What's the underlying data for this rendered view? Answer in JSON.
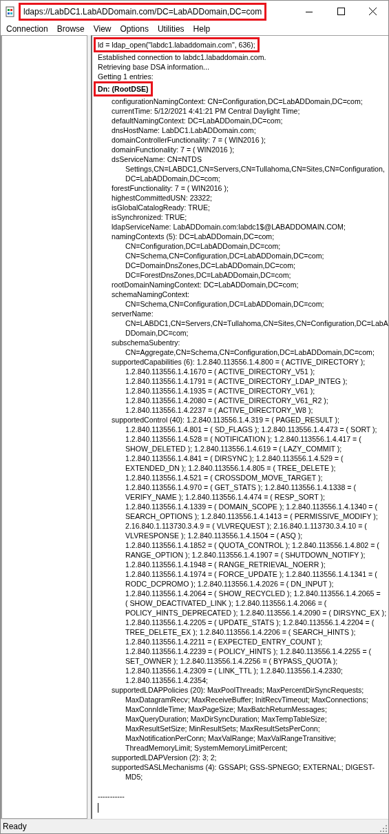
{
  "window": {
    "title": "ldaps://LabDC1.LabADDomain.com/DC=LabADDomain,DC=com",
    "title_highlighted": true
  },
  "menu": [
    "Connection",
    "Browse",
    "View",
    "Options",
    "Utilities",
    "Help"
  ],
  "log": [
    {
      "kind": "plain",
      "text": "ld = ldap_open(\"labdc1.labaddomain.com\", 636);",
      "highlighted": true
    },
    {
      "kind": "plain",
      "text": "Established connection to labdc1.labaddomain.com.",
      "highlighted": false
    },
    {
      "kind": "plain",
      "text": "Retrieving base DSA information...",
      "highlighted": false
    },
    {
      "kind": "plain",
      "text": "Getting 1 entries:",
      "highlighted": false
    },
    {
      "kind": "heading",
      "text": "Dn: (RootDSE)",
      "highlighted": true
    },
    {
      "kind": "attr",
      "text": "configurationNamingContext: CN=Configuration,DC=LabADDomain,DC=com;",
      "highlighted": false
    },
    {
      "kind": "attr",
      "text": "currentTime: 5/12/2021 4:41:21 PM Central Daylight Time;",
      "highlighted": false
    },
    {
      "kind": "attr",
      "text": "defaultNamingContext: DC=LabADDomain,DC=com;",
      "highlighted": false
    },
    {
      "kind": "attr",
      "text": "dnsHostName: LabDC1.LabADDomain.com;",
      "highlighted": false
    },
    {
      "kind": "attr",
      "text": "domainControllerFunctionality: 7 = ( WIN2016 );",
      "highlighted": false
    },
    {
      "kind": "attr",
      "text": "domainFunctionality: 7 = ( WIN2016 );",
      "highlighted": false
    },
    {
      "kind": "attr",
      "text": "dsServiceName: CN=NTDS",
      "highlighted": false
    },
    {
      "kind": "cont",
      "text": "Settings,CN=LABDC1,CN=Servers,CN=Tullahoma,CN=Sites,CN=Configuration,",
      "highlighted": false
    },
    {
      "kind": "cont",
      "text": "DC=LabADDomain,DC=com;",
      "highlighted": false
    },
    {
      "kind": "attr",
      "text": "forestFunctionality: 7 = ( WIN2016 );",
      "highlighted": false
    },
    {
      "kind": "attr",
      "text": "highestCommittedUSN: 23322;",
      "highlighted": false
    },
    {
      "kind": "attr",
      "text": "isGlobalCatalogReady: TRUE;",
      "highlighted": false
    },
    {
      "kind": "attr",
      "text": "isSynchronized: TRUE;",
      "highlighted": false
    },
    {
      "kind": "attr",
      "text": "ldapServiceName: LabADDomain.com:labdc1$@LABADDOMAIN.COM;",
      "highlighted": false
    },
    {
      "kind": "attr",
      "text": "namingContexts (5): DC=LabADDomain,DC=com;",
      "highlighted": false
    },
    {
      "kind": "cont",
      "text": "CN=Configuration,DC=LabADDomain,DC=com;",
      "highlighted": false
    },
    {
      "kind": "cont",
      "text": "CN=Schema,CN=Configuration,DC=LabADDomain,DC=com;",
      "highlighted": false
    },
    {
      "kind": "cont",
      "text": "DC=DomainDnsZones,DC=LabADDomain,DC=com;",
      "highlighted": false
    },
    {
      "kind": "cont",
      "text": "DC=ForestDnsZones,DC=LabADDomain,DC=com;",
      "highlighted": false
    },
    {
      "kind": "attr",
      "text": "rootDomainNamingContext: DC=LabADDomain,DC=com;",
      "highlighted": false
    },
    {
      "kind": "attr",
      "text": "schemaNamingContext:",
      "highlighted": false
    },
    {
      "kind": "cont",
      "text": "CN=Schema,CN=Configuration,DC=LabADDomain,DC=com;",
      "highlighted": false
    },
    {
      "kind": "attr",
      "text": "serverName:",
      "highlighted": false
    },
    {
      "kind": "cont",
      "text": "CN=LABDC1,CN=Servers,CN=Tullahoma,CN=Sites,CN=Configuration,DC=LabA",
      "highlighted": false
    },
    {
      "kind": "cont",
      "text": "DDomain,DC=com;",
      "highlighted": false
    },
    {
      "kind": "attr",
      "text": "subschemaSubentry:",
      "highlighted": false
    },
    {
      "kind": "cont",
      "text": "CN=Aggregate,CN=Schema,CN=Configuration,DC=LabADDomain,DC=com;",
      "highlighted": false
    },
    {
      "kind": "attr",
      "text": "supportedCapabilities (6): 1.2.840.113556.1.4.800 = ( ACTIVE_DIRECTORY );",
      "highlighted": false
    },
    {
      "kind": "cont",
      "text": "1.2.840.113556.1.4.1670 = ( ACTIVE_DIRECTORY_V51 );",
      "highlighted": false
    },
    {
      "kind": "cont",
      "text": "1.2.840.113556.1.4.1791 = ( ACTIVE_DIRECTORY_LDAP_INTEG );",
      "highlighted": false
    },
    {
      "kind": "cont",
      "text": "1.2.840.113556.1.4.1935 = ( ACTIVE_DIRECTORY_V61 );",
      "highlighted": false
    },
    {
      "kind": "cont",
      "text": "1.2.840.113556.1.4.2080 = ( ACTIVE_DIRECTORY_V61_R2 );",
      "highlighted": false
    },
    {
      "kind": "cont",
      "text": "1.2.840.113556.1.4.2237 = ( ACTIVE_DIRECTORY_W8 );",
      "highlighted": false
    },
    {
      "kind": "attr",
      "text": "supportedControl (40): 1.2.840.113556.1.4.319 = ( PAGED_RESULT );",
      "highlighted": false
    },
    {
      "kind": "cont",
      "text": "1.2.840.113556.1.4.801 = ( SD_FLAGS ); 1.2.840.113556.1.4.473 = ( SORT );",
      "highlighted": false
    },
    {
      "kind": "cont",
      "text": "1.2.840.113556.1.4.528 = ( NOTIFICATION ); 1.2.840.113556.1.4.417 = (",
      "highlighted": false
    },
    {
      "kind": "cont",
      "text": "SHOW_DELETED ); 1.2.840.113556.1.4.619 = ( LAZY_COMMIT );",
      "highlighted": false
    },
    {
      "kind": "cont",
      "text": "1.2.840.113556.1.4.841 = ( DIRSYNC ); 1.2.840.113556.1.4.529 = (",
      "highlighted": false
    },
    {
      "kind": "cont",
      "text": "EXTENDED_DN ); 1.2.840.113556.1.4.805 = ( TREE_DELETE );",
      "highlighted": false
    },
    {
      "kind": "cont",
      "text": "1.2.840.113556.1.4.521 = ( CROSSDOM_MOVE_TARGET );",
      "highlighted": false
    },
    {
      "kind": "cont",
      "text": "1.2.840.113556.1.4.970 = ( GET_STATS ); 1.2.840.113556.1.4.1338 = (",
      "highlighted": false
    },
    {
      "kind": "cont",
      "text": "VERIFY_NAME ); 1.2.840.113556.1.4.474 = ( RESP_SORT );",
      "highlighted": false
    },
    {
      "kind": "cont",
      "text": "1.2.840.113556.1.4.1339 = ( DOMAIN_SCOPE ); 1.2.840.113556.1.4.1340 = (",
      "highlighted": false
    },
    {
      "kind": "cont",
      "text": "SEARCH_OPTIONS ); 1.2.840.113556.1.4.1413 = ( PERMISSIVE_MODIFY );",
      "highlighted": false
    },
    {
      "kind": "cont",
      "text": "2.16.840.1.113730.3.4.9 = ( VLVREQUEST ); 2.16.840.1.113730.3.4.10 = (",
      "highlighted": false
    },
    {
      "kind": "cont",
      "text": "VLVRESPONSE ); 1.2.840.113556.1.4.1504 = ( ASQ );",
      "highlighted": false
    },
    {
      "kind": "cont",
      "text": "1.2.840.113556.1.4.1852 = ( QUOTA_CONTROL ); 1.2.840.113556.1.4.802 = (",
      "highlighted": false
    },
    {
      "kind": "cont",
      "text": "RANGE_OPTION ); 1.2.840.113556.1.4.1907 = ( SHUTDOWN_NOTIFY );",
      "highlighted": false
    },
    {
      "kind": "cont",
      "text": "1.2.840.113556.1.4.1948 = ( RANGE_RETRIEVAL_NOERR );",
      "highlighted": false
    },
    {
      "kind": "cont",
      "text": "1.2.840.113556.1.4.1974 = ( FORCE_UPDATE ); 1.2.840.113556.1.4.1341 = (",
      "highlighted": false
    },
    {
      "kind": "cont",
      "text": "RODC_DCPROMO ); 1.2.840.113556.1.4.2026 = ( DN_INPUT );",
      "highlighted": false
    },
    {
      "kind": "cont",
      "text": "1.2.840.113556.1.4.2064 = ( SHOW_RECYCLED ); 1.2.840.113556.1.4.2065 =",
      "highlighted": false
    },
    {
      "kind": "cont",
      "text": "( SHOW_DEACTIVATED_LINK ); 1.2.840.113556.1.4.2066 = (",
      "highlighted": false
    },
    {
      "kind": "cont",
      "text": "POLICY_HINTS_DEPRECATED ); 1.2.840.113556.1.4.2090 = ( DIRSYNC_EX );",
      "highlighted": false
    },
    {
      "kind": "cont",
      "text": "1.2.840.113556.1.4.2205 = ( UPDATE_STATS ); 1.2.840.113556.1.4.2204 = (",
      "highlighted": false
    },
    {
      "kind": "cont",
      "text": "TREE_DELETE_EX ); 1.2.840.113556.1.4.2206 = ( SEARCH_HINTS );",
      "highlighted": false
    },
    {
      "kind": "cont",
      "text": "1.2.840.113556.1.4.2211 = ( EXPECTED_ENTRY_COUNT );",
      "highlighted": false
    },
    {
      "kind": "cont",
      "text": "1.2.840.113556.1.4.2239 = ( POLICY_HINTS ); 1.2.840.113556.1.4.2255 = (",
      "highlighted": false
    },
    {
      "kind": "cont",
      "text": "SET_OWNER ); 1.2.840.113556.1.4.2256 = ( BYPASS_QUOTA );",
      "highlighted": false
    },
    {
      "kind": "cont",
      "text": "1.2.840.113556.1.4.2309 = ( LINK_TTL ); 1.2.840.113556.1.4.2330;",
      "highlighted": false
    },
    {
      "kind": "cont",
      "text": "1.2.840.113556.1.4.2354;",
      "highlighted": false
    },
    {
      "kind": "attr",
      "text": "supportedLDAPPolicies (20): MaxPoolThreads; MaxPercentDirSyncRequests;",
      "highlighted": false
    },
    {
      "kind": "cont",
      "text": "MaxDatagramRecv; MaxReceiveBuffer; InitRecvTimeout; MaxConnections;",
      "highlighted": false
    },
    {
      "kind": "cont",
      "text": "MaxConnIdleTime; MaxPageSize; MaxBatchReturnMessages;",
      "highlighted": false
    },
    {
      "kind": "cont",
      "text": "MaxQueryDuration; MaxDirSyncDuration; MaxTempTableSize;",
      "highlighted": false
    },
    {
      "kind": "cont",
      "text": "MaxResultSetSize; MinResultSets; MaxResultSetsPerConn;",
      "highlighted": false
    },
    {
      "kind": "cont",
      "text": "MaxNotificationPerConn; MaxValRange; MaxValRangeTransitive;",
      "highlighted": false
    },
    {
      "kind": "cont",
      "text": "ThreadMemoryLimit; SystemMemoryLimitPercent;",
      "highlighted": false
    },
    {
      "kind": "attr",
      "text": "supportedLDAPVersion (2): 3; 2;",
      "highlighted": false
    },
    {
      "kind": "attr",
      "text": "supportedSASLMechanisms (4): GSSAPI; GSS-SPNEGO; EXTERNAL; DIGEST-",
      "highlighted": false
    },
    {
      "kind": "cont",
      "text": "MD5;",
      "highlighted": false
    },
    {
      "kind": "separator",
      "text": "-----------",
      "highlighted": false
    }
  ],
  "status_bar": "Ready"
}
